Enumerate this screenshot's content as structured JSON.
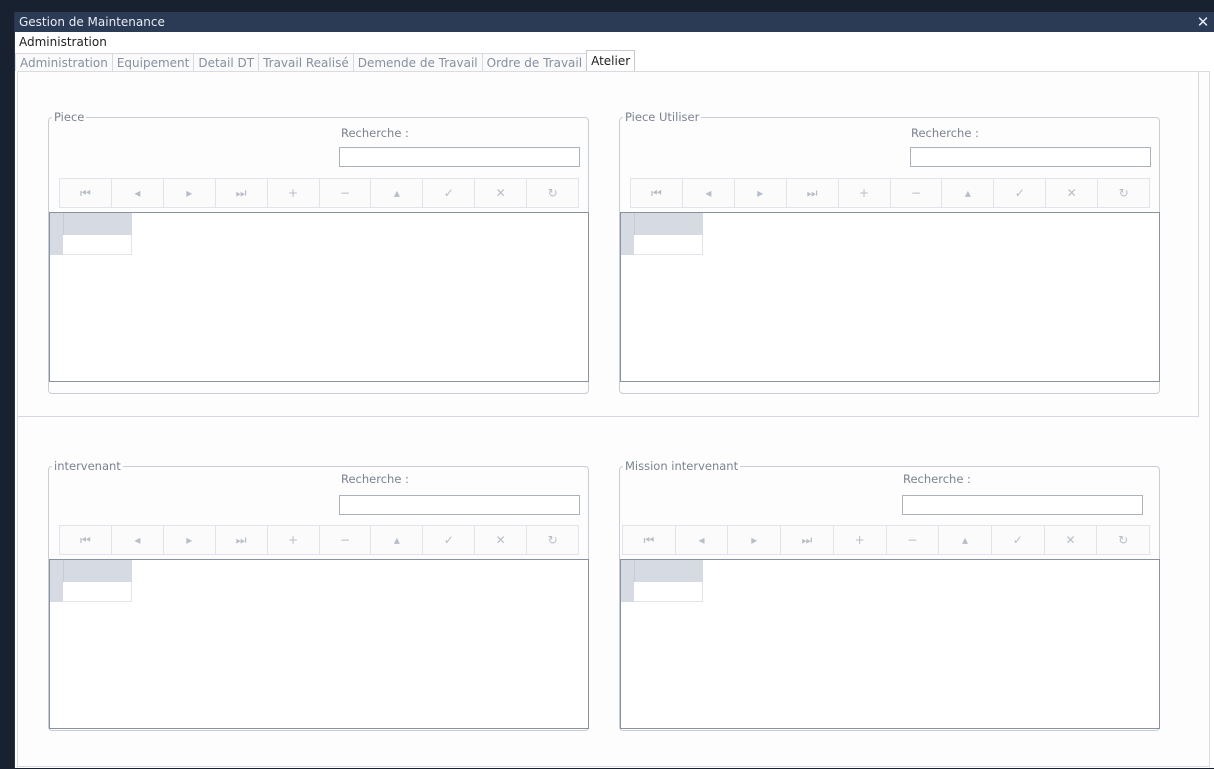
{
  "window": {
    "title": "Gestion de Maintenance",
    "close_glyph": "✕"
  },
  "menu": {
    "label": "Administration"
  },
  "tabs": [
    {
      "label": "Administration",
      "active": false
    },
    {
      "label": "Equipement",
      "active": false
    },
    {
      "label": "Detail DT",
      "active": false
    },
    {
      "label": "Travail Realisé",
      "active": false
    },
    {
      "label": "Demende de Travail",
      "active": false
    },
    {
      "label": "Ordre de Travail",
      "active": false
    },
    {
      "label": "Atelier",
      "active": true
    }
  ],
  "panels": {
    "piece": {
      "title": "Piece",
      "search_label": "Recherche :",
      "search_value": ""
    },
    "piece_utiliser": {
      "title": "Piece Utiliser",
      "search_label": "Recherche :",
      "search_value": ""
    },
    "intervenant": {
      "title": "intervenant",
      "search_label": "Recherche :",
      "search_value": ""
    },
    "mission_intervenant": {
      "title": "Mission intervenant",
      "search_label": "Recherche :",
      "search_value": ""
    }
  },
  "navigator": {
    "icons": [
      {
        "name": "first-icon",
        "glyph": "⏮"
      },
      {
        "name": "prev-icon",
        "glyph": "◂"
      },
      {
        "name": "next-icon",
        "glyph": "▸"
      },
      {
        "name": "last-icon",
        "glyph": "⏭"
      },
      {
        "name": "add-icon",
        "glyph": "+"
      },
      {
        "name": "delete-icon",
        "glyph": "−"
      },
      {
        "name": "edit-icon",
        "glyph": "▴"
      },
      {
        "name": "post-icon",
        "glyph": "✓"
      },
      {
        "name": "cancel-icon",
        "glyph": "✕"
      },
      {
        "name": "refresh-icon",
        "glyph": "↻"
      }
    ]
  },
  "colors": {
    "titlebar": "#2b3a55",
    "grid_header": "#d6dae3",
    "tab_inactive_text": "#8590a0"
  }
}
